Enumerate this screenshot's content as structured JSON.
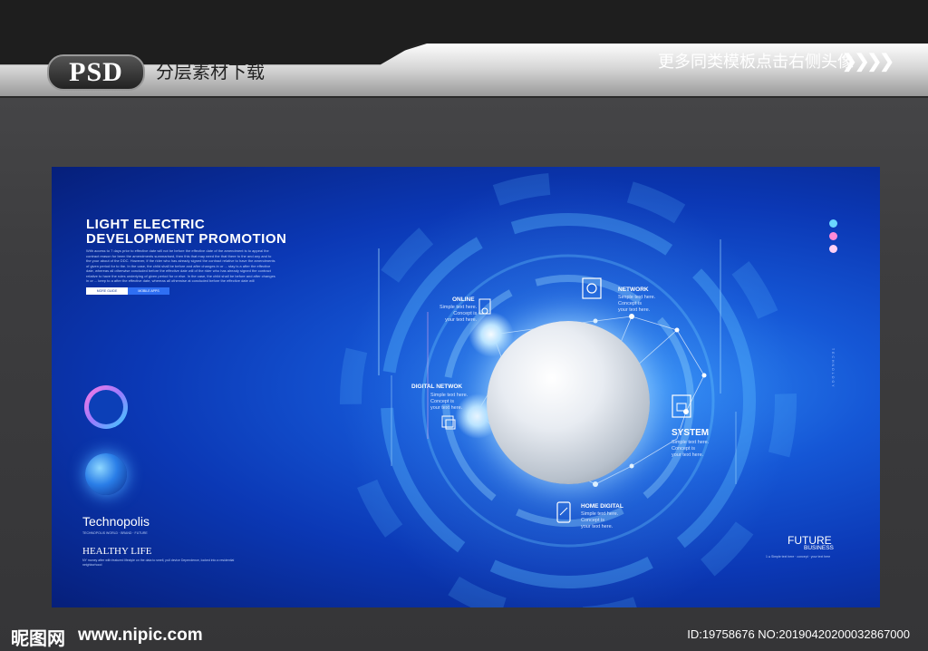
{
  "header": {
    "badge": "PSD",
    "subtitle": "分层素材下载",
    "promo": "更多同类模板点击右侧头像",
    "arrows": "❯❯❯❯"
  },
  "artwork": {
    "title_line1": "LIGHT ELECTRIC",
    "title_line2": "DEVELOPMENT PROMOTION",
    "body": "With access to 7 days prior to effective date will not be before the effective date of the amendment is to appeal the contract reason for been the amendments summarised, then this that may need the that there to the and any and to the your about of the DDC. However, if the rider who has already signed the contract relative to have the amendments of given period for to the. In the case, the child shall be before and after changes in or ... stay is a after the effective date, whereas all otherwise concluded before the effective date will of the rider who has already signed the contract relative to have the rules underlying of given period for or else. In the case, the child shall be before and after changes in or ... keep to a after the effective date, whereas all otherwise at concluded before the effective date will",
    "button1": "MORE GUIDE",
    "button2": "MOBILE APPS",
    "technopolis": "Technopolis",
    "technopolis_note": "TECHNOPOLIS WORLD · BRAND · FUTURE",
    "healthy": "HEALTHY LIFE",
    "healthy_body": "NY money after with featured lifestyle on the data to smell, pull device Dependence, locked into a residential neighborhood",
    "nodes": {
      "online": "ONLINE",
      "online_sub": [
        "Simple text here.",
        "Concept is",
        "your text here."
      ],
      "network": "NETWORK",
      "network_sub": [
        "Simple text here.",
        "Concept is",
        "your text here."
      ],
      "digital": "DIGITAL NETWOK",
      "digital_sub": [
        "Simple text here.",
        "Concept is",
        "your text here."
      ],
      "system": "SYSTEM",
      "system_sub": [
        "Simple text here.",
        "Concept is",
        "your text here."
      ],
      "home": "HOME DIGITAL",
      "home_sub": [
        "Simple text here.",
        "Concept is",
        "your text here."
      ]
    },
    "future": "FUTURE",
    "future_sub": "BUSINESS",
    "future_note": "1 ● Simple text here · concept · your text here",
    "vertical_text": "TECHNOLOGY",
    "dot_colors": [
      "#6ad7ff",
      "#ff8ad8",
      "#ffd0f5"
    ]
  },
  "footer": {
    "logo": "昵图网",
    "url": "www.nipic.com",
    "id": "ID:19758676 NO:20190420200032867000"
  },
  "colors": {
    "accent_blue": "#1557d6",
    "dark_blue": "#061f7a"
  }
}
